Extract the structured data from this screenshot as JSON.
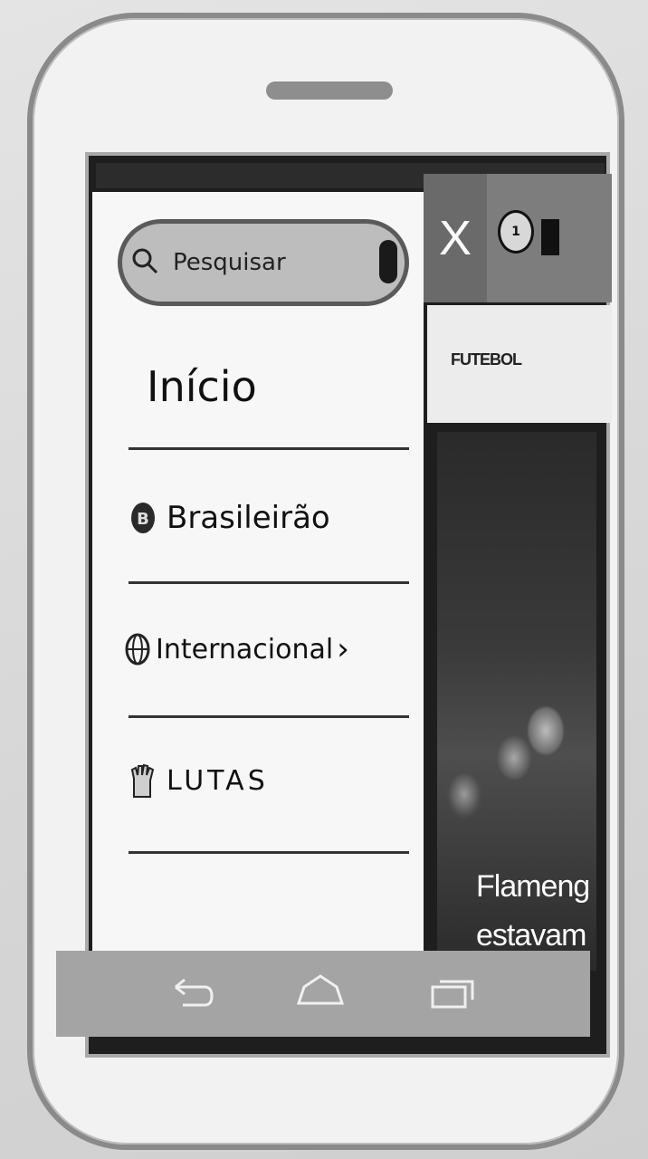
{
  "drawer": {
    "search": {
      "placeholder": "Pesquisar"
    },
    "items": [
      {
        "label": "Início",
        "icon": "home-none"
      },
      {
        "label": "Brasileirão",
        "icon": "brasileirao-logo-icon"
      },
      {
        "label": "Internacional",
        "icon": "globe-icon",
        "chevron": "›"
      },
      {
        "label": "LUTAS",
        "icon": "glove-icon"
      }
    ]
  },
  "appbar": {
    "close_label": "X",
    "team_badge": "1",
    "subheader": "FUTEBOL"
  },
  "news": {
    "caption_line1": "Flameng",
    "caption_line2": "estavam"
  },
  "colors": {
    "drawer_bg": "#f7f7f7",
    "appbar": "#7d7d7d",
    "navbar": "#a4a4a4"
  }
}
